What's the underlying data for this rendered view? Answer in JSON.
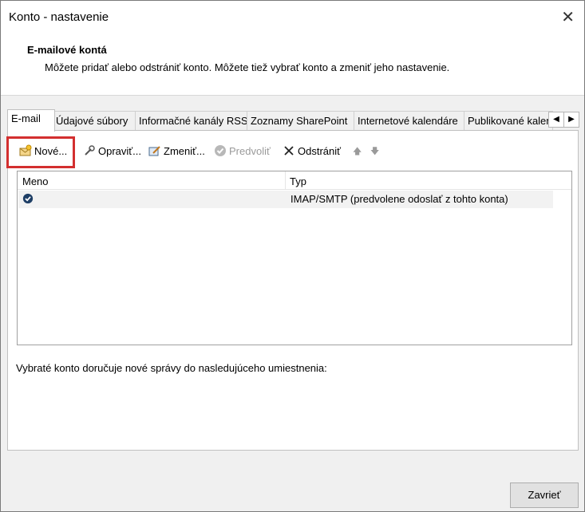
{
  "window": {
    "title": "Konto - nastavenie"
  },
  "header": {
    "subtitle": "E-mailové kontá",
    "description": "Môžete pridať alebo odstrániť konto. Môžete tiež vybrať konto a zmeniť jeho nastavenie."
  },
  "tabs": [
    {
      "label": "E-mail"
    },
    {
      "label": "Údajové súbory"
    },
    {
      "label": "Informačné kanály RSS"
    },
    {
      "label": "Zoznamy SharePoint"
    },
    {
      "label": "Internetové kalendáre"
    },
    {
      "label": "Publikované kalendáre"
    }
  ],
  "toolbar": {
    "new": "Nové...",
    "repair": "Opraviť...",
    "change": "Zmeniť...",
    "default": "Predvoliť",
    "remove": "Odstrániť"
  },
  "list": {
    "columns": [
      "Meno",
      "Typ"
    ],
    "rows": [
      {
        "name": "",
        "type": "IMAP/SMTP (predvolene odoslať z tohto konta)"
      }
    ]
  },
  "deliver_text": "Vybraté konto doručuje nové správy do nasledujúceho umiestnenia:",
  "buttons": {
    "close": "Zavrieť"
  },
  "colors": {
    "highlight": "#d32f2f",
    "checkmark": "#1f3f66"
  }
}
